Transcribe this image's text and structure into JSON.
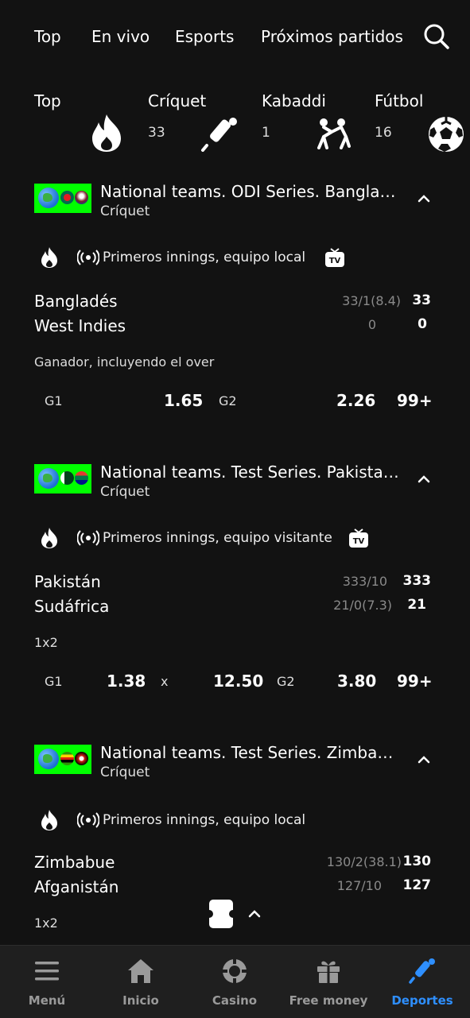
{
  "top_nav": {
    "tabs": [
      "Top",
      "En vivo",
      "Esports",
      "Próximos partidos"
    ]
  },
  "sports": [
    {
      "name": "Top",
      "count": "",
      "icon": "fire-icon"
    },
    {
      "name": "Críquet",
      "count": "33",
      "icon": "cricket-bat-icon"
    },
    {
      "name": "Kabaddi",
      "count": "1",
      "icon": "kabaddi-icon"
    },
    {
      "name": "Fútbol",
      "count": "16",
      "icon": "soccer-ball-icon"
    }
  ],
  "events": [
    {
      "league": "National teams. ODI Series. Banglade...",
      "sport": "Críquet",
      "period": "Primeros innings, equipo local",
      "has_tv": true,
      "team1": "Bangladés",
      "team1_detail": "33/1(8.4)",
      "team1_score": "33",
      "team2": "West Indies",
      "team2_detail": "0",
      "team2_score": "0",
      "market": "Ganador, incluyendo el over",
      "odds": {
        "g1_label": "G1",
        "g1": "1.65",
        "g2_label": "G2",
        "g2": "2.26",
        "more": "99+"
      }
    },
    {
      "league": "National teams. Test Series. Pakistan ...",
      "sport": "Críquet",
      "period": "Primeros innings, equipo visitante",
      "has_tv": true,
      "team1": "Pakistán",
      "team1_detail": "333/10",
      "team1_score": "333",
      "team2": "Sudáfrica",
      "team2_detail": "21/0(7.3)",
      "team2_score": "21",
      "market": "1x2",
      "odds": {
        "g1_label": "G1",
        "g1": "1.38",
        "x_label": "x",
        "x": "12.50",
        "g2_label": "G2",
        "g2": "3.80",
        "more": "99+"
      }
    },
    {
      "league": "National teams. Test Series. Zimbabw...",
      "sport": "Críquet",
      "period": "Primeros innings, equipo local",
      "has_tv": false,
      "team1": "Zimbabue",
      "team1_detail": "130/2(38.1)",
      "team1_score": "130",
      "team2": "Afganistán",
      "team2_detail": "127/10",
      "team2_score": "127",
      "market": "1x2"
    }
  ],
  "bottom_nav": [
    {
      "label": "Menú",
      "icon": "hamburger-menu-icon"
    },
    {
      "label": "Inicio",
      "icon": "home-icon"
    },
    {
      "label": "Casino",
      "icon": "casino-chip-icon"
    },
    {
      "label": "Free money",
      "icon": "gift-icon"
    },
    {
      "label": "Deportes",
      "icon": "sports-icon"
    }
  ],
  "colors": {
    "background": "#121212",
    "accent": "#2e8fff",
    "flag_bg": "#00ff00",
    "nav_bg": "#1f1f1f"
  }
}
